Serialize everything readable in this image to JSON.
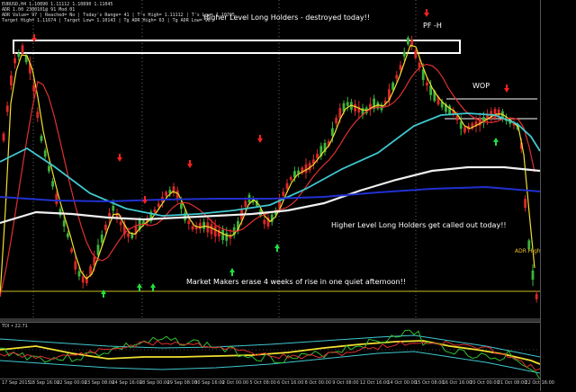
{
  "header": {
    "symbol_line": "EURUSD,H4 1.10890 1.11112 1.10890 1.11045",
    "line2": "ADR 1.00 2300101@ 91 Mod 01",
    "line3": "ADR Value= 97 | Reached= No | Today's Range= 41 | T's High= 1.11112 | T's Low= 1.10705",
    "line4": "Target High= 1.11674 | Target Low= 1.10143 | Tg ADR High= 63 | Tg ADR Low= 90"
  },
  "annotations": {
    "top_title": "Higher Level Long Holders - destroyed today!!",
    "pf_h": "PF -H",
    "wop": "WOP",
    "called_out": "Higher Level Long Holders get called out today!!",
    "market_makers": "Market Makers erase 4 weeks of rise in  one quiet afternoon!!",
    "adr_high": "ADR High"
  },
  "subwindow": {
    "label": "TDI • 22.71"
  },
  "date_axis": {
    "labels": [
      "17 Sep 2015",
      "18 Sep 16:00",
      "22 Sep 00:00",
      "23 Sep 08:00",
      "24 Sep 16:00",
      "28 Sep 00:00",
      "29 Sep 08:00",
      "30 Sep 16:00",
      "2 Oct 00:00",
      "5 Oct 08:00",
      "6 Oct 16:00",
      "8 Oct 00:00",
      "9 Oct 08:00",
      "12 Oct 16:00",
      "14 Oct 00:00",
      "15 Oct 08:00",
      "16 Oct 16:00",
      "20 Oct 00:00",
      "21 Oct 08:00",
      "22 Oct 16:00"
    ]
  },
  "colors": {
    "bull": "#3cb43c",
    "bear": "#dc2828",
    "ma_yellow": "#f0e030",
    "ma_red": "#e03030",
    "ma_cyan": "#40c8d0",
    "ma_white": "#f0f0f0",
    "ma_blue": "#2030d0",
    "arrow_up": "#20e040",
    "arrow_down": "#ff2020"
  }
}
